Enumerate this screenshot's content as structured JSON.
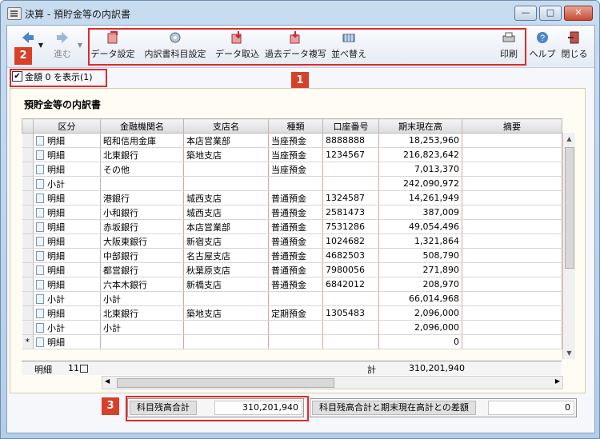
{
  "window": {
    "title": "決算 - 預貯金等の内訳書",
    "minimize": "—",
    "maximize": "□",
    "close": "✕"
  },
  "toolbar": {
    "back_label": "",
    "forward_label": "進む",
    "buttons": [
      {
        "label": "データ設定",
        "icon": "data-settings-icon"
      },
      {
        "label": "内訳書科目設定",
        "icon": "account-settings-icon"
      },
      {
        "label": "データ取込",
        "icon": "data-import-icon"
      },
      {
        "label": "過去データ複写",
        "icon": "past-data-copy-icon"
      },
      {
        "label": "並べ替え",
        "icon": "sort-icon"
      }
    ],
    "print_label": "印刷",
    "help_label": "ヘルプ",
    "close_label": "閉じる"
  },
  "badges": {
    "b1": "1",
    "b2": "2",
    "b3": "3"
  },
  "checkbox": {
    "label": "金額 0 を表示(1)",
    "checked": "✔"
  },
  "sheet": {
    "title": "預貯金等の内訳書"
  },
  "table": {
    "headers": [
      "区分",
      "金融機関名",
      "支店名",
      "種類",
      "口座番号",
      "期末現在高",
      "摘要"
    ],
    "rows": [
      {
        "sel": "",
        "kubun": "明細",
        "bank": "昭和信用金庫",
        "branch": "本店営業部",
        "kind": "当座預金",
        "acct": "8888888",
        "amount": "18,253,960",
        "note": ""
      },
      {
        "sel": "",
        "kubun": "明細",
        "bank": "北東銀行",
        "branch": "築地支店",
        "kind": "当座預金",
        "acct": "1234567",
        "amount": "216,823,642",
        "note": ""
      },
      {
        "sel": "",
        "kubun": "明細",
        "bank": "その他",
        "branch": "",
        "kind": "当座預金",
        "acct": "",
        "amount": "7,013,370",
        "note": ""
      },
      {
        "sel": "",
        "kubun": "小計",
        "bank": "",
        "branch": "",
        "kind": "",
        "acct": "",
        "amount": "242,090,972",
        "note": ""
      },
      {
        "sel": "",
        "kubun": "明細",
        "bank": "港銀行",
        "branch": "城西支店",
        "kind": "普通預金",
        "acct": "1324587",
        "amount": "14,261,949",
        "note": ""
      },
      {
        "sel": "",
        "kubun": "明細",
        "bank": "小和銀行",
        "branch": "城西支店",
        "kind": "普通預金",
        "acct": "2581473",
        "amount": "387,009",
        "note": ""
      },
      {
        "sel": "",
        "kubun": "明細",
        "bank": "赤坂銀行",
        "branch": "本店営業部",
        "kind": "普通預金",
        "acct": "7531286",
        "amount": "49,054,496",
        "note": ""
      },
      {
        "sel": "",
        "kubun": "明細",
        "bank": "大阪東銀行",
        "branch": "新宿支店",
        "kind": "普通預金",
        "acct": "1024682",
        "amount": "1,321,864",
        "note": ""
      },
      {
        "sel": "",
        "kubun": "明細",
        "bank": "中部銀行",
        "branch": "名古屋支店",
        "kind": "普通預金",
        "acct": "4682503",
        "amount": "508,790",
        "note": ""
      },
      {
        "sel": "",
        "kubun": "明細",
        "bank": "都営銀行",
        "branch": "秋葉原支店",
        "kind": "普通預金",
        "acct": "7980056",
        "amount": "271,890",
        "note": ""
      },
      {
        "sel": "",
        "kubun": "明細",
        "bank": "六本木銀行",
        "branch": "新橋支店",
        "kind": "普通預金",
        "acct": "6842012",
        "amount": "208,970",
        "note": ""
      },
      {
        "sel": "",
        "kubun": "小計",
        "bank": "小計",
        "branch": "",
        "kind": "",
        "acct": "",
        "amount": "66,014,968",
        "note": ""
      },
      {
        "sel": "",
        "kubun": "明細",
        "bank": "北東銀行",
        "branch": "築地支店",
        "kind": "定期預金",
        "acct": "1305483",
        "amount": "2,096,000",
        "note": ""
      },
      {
        "sel": "",
        "kubun": "小計",
        "bank": "小計",
        "branch": "",
        "kind": "",
        "acct": "",
        "amount": "2,096,000",
        "note": ""
      },
      {
        "sel": "*",
        "kubun": "明細",
        "bank": "",
        "branch": "",
        "kind": "",
        "acct": "",
        "amount": "0",
        "note": ""
      }
    ],
    "footer": {
      "kubun": "明細",
      "count": "11",
      "total_label": "計",
      "total": "310,201,940"
    }
  },
  "summary": {
    "balance_label": "科目残高合計",
    "balance_value": "310,201,940",
    "diff_label": "科目残高合計と期末現在高計との差額",
    "diff_value": "0"
  }
}
